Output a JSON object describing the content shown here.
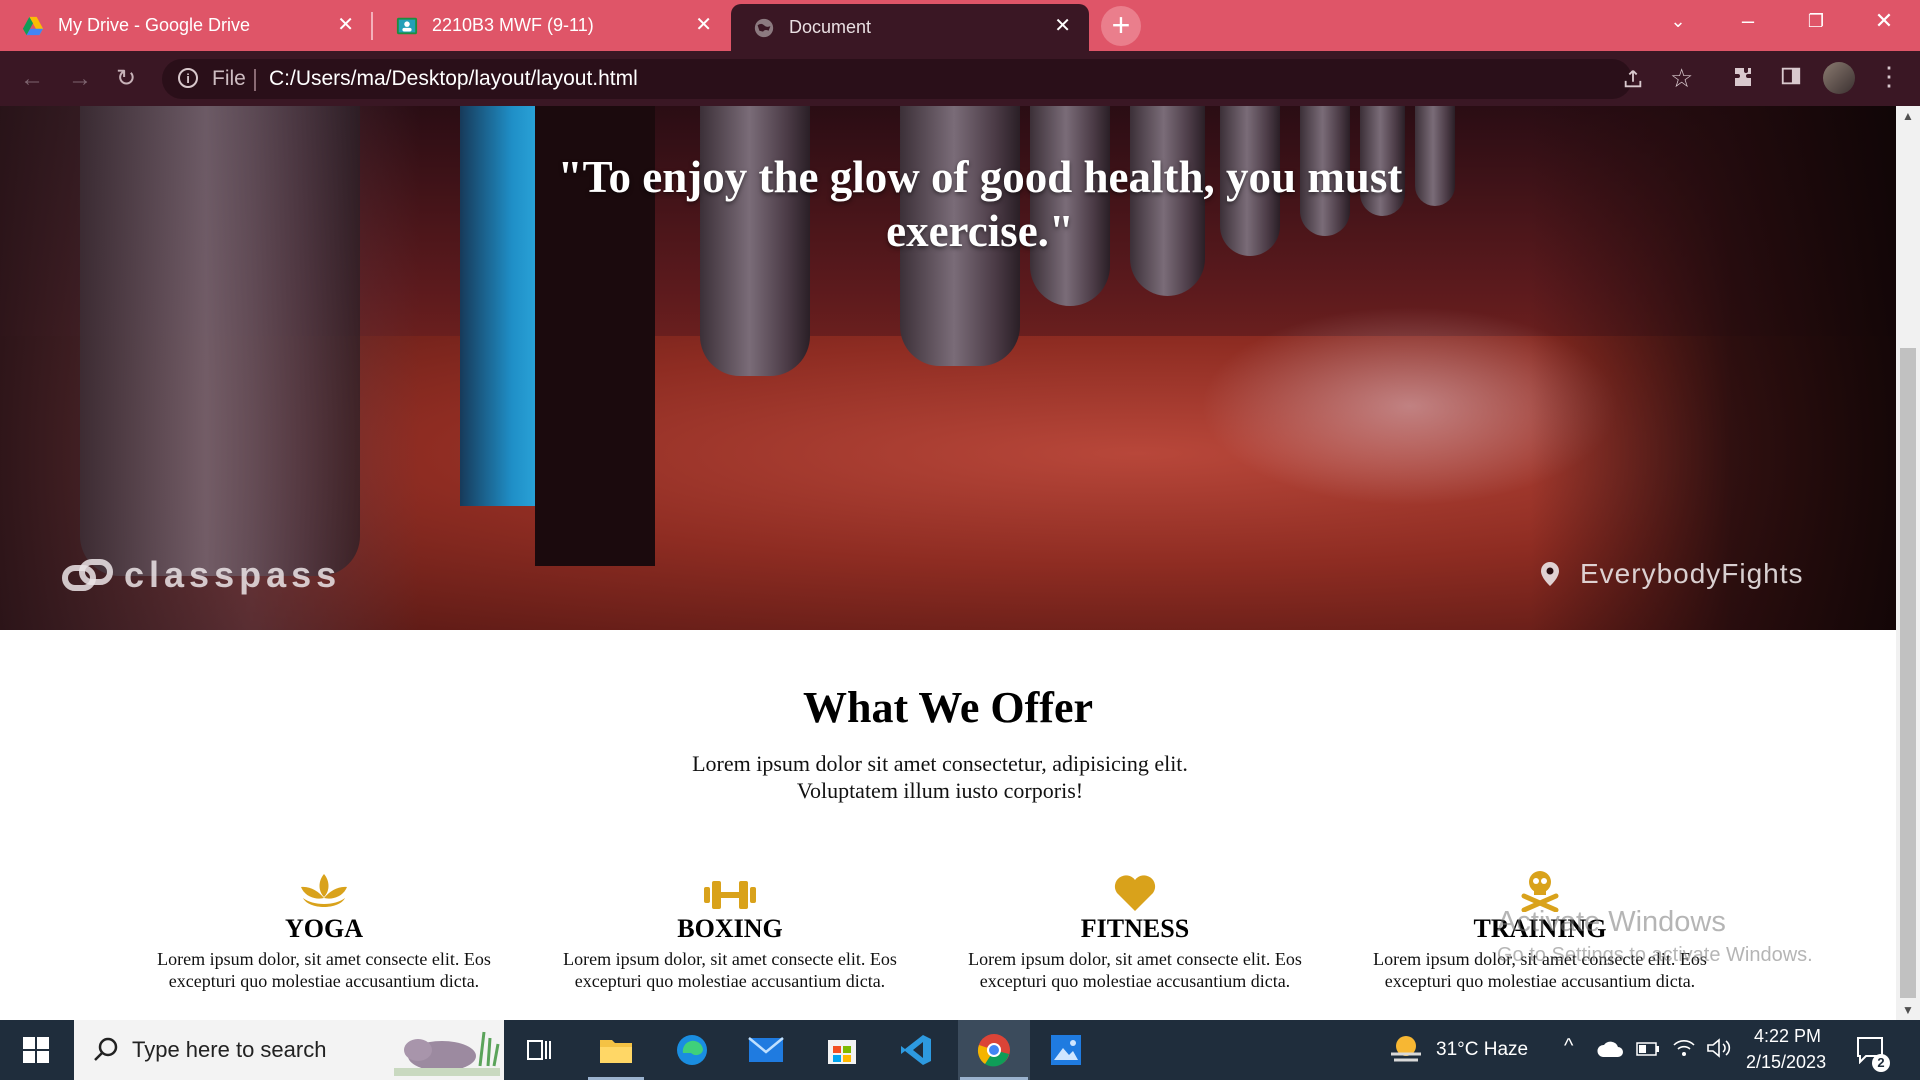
{
  "browser": {
    "tabs": [
      {
        "title": "My Drive - Google Drive",
        "icon": "google-drive-icon"
      },
      {
        "title": "2210B3 MWF (9-11)",
        "icon": "classroom-icon"
      },
      {
        "title": "Document",
        "icon": "globe-icon",
        "active": true
      }
    ],
    "address": {
      "scheme_label": "File",
      "url": "C:/Users/ma/Desktop/layout/layout.html"
    },
    "accent": "#df5568",
    "toolbar_bg": "#3a1724"
  },
  "page": {
    "hero": {
      "quote": "\"To enjoy the glow of good health, you must exercise.\"",
      "watermark_brand": "classpass",
      "watermark_location": "EverybodyFights"
    },
    "offer": {
      "title": "What We Offer",
      "subtitle": "Lorem ipsum dolor sit amet consectetur, adipisicing elit. Voluptatem illum iusto corporis!",
      "icon_color": "#d9a21b",
      "cards": [
        {
          "icon": "lotus-icon",
          "title": "YOGA",
          "text": "Lorem ipsum dolor, sit amet consecte elit. Eos excepturi quo molestiae accusantium dicta."
        },
        {
          "icon": "dumbbell-icon",
          "title": "BOXING",
          "text": "Lorem ipsum dolor, sit amet consecte elit. Eos excepturi quo molestiae accusantium dicta."
        },
        {
          "icon": "heart-icon",
          "title": "FITNESS",
          "text": "Lorem ipsum dolor, sit amet consecte elit. Eos excepturi quo molestiae accusantium dicta."
        },
        {
          "icon": "skull-crossbones-icon",
          "title": "TRAINING",
          "text": "Lorem ipsum dolor, sit amet consecte elit. Eos excepturi quo molestiae accusantium dicta."
        }
      ]
    }
  },
  "os": {
    "activate_title": "Activate Windows",
    "activate_sub": "Go to Settings to activate Windows.",
    "search_placeholder": "Type here to search",
    "weather": "31°C  Haze",
    "time": "4:22 PM",
    "date": "2/15/2023",
    "notifications": "2"
  }
}
